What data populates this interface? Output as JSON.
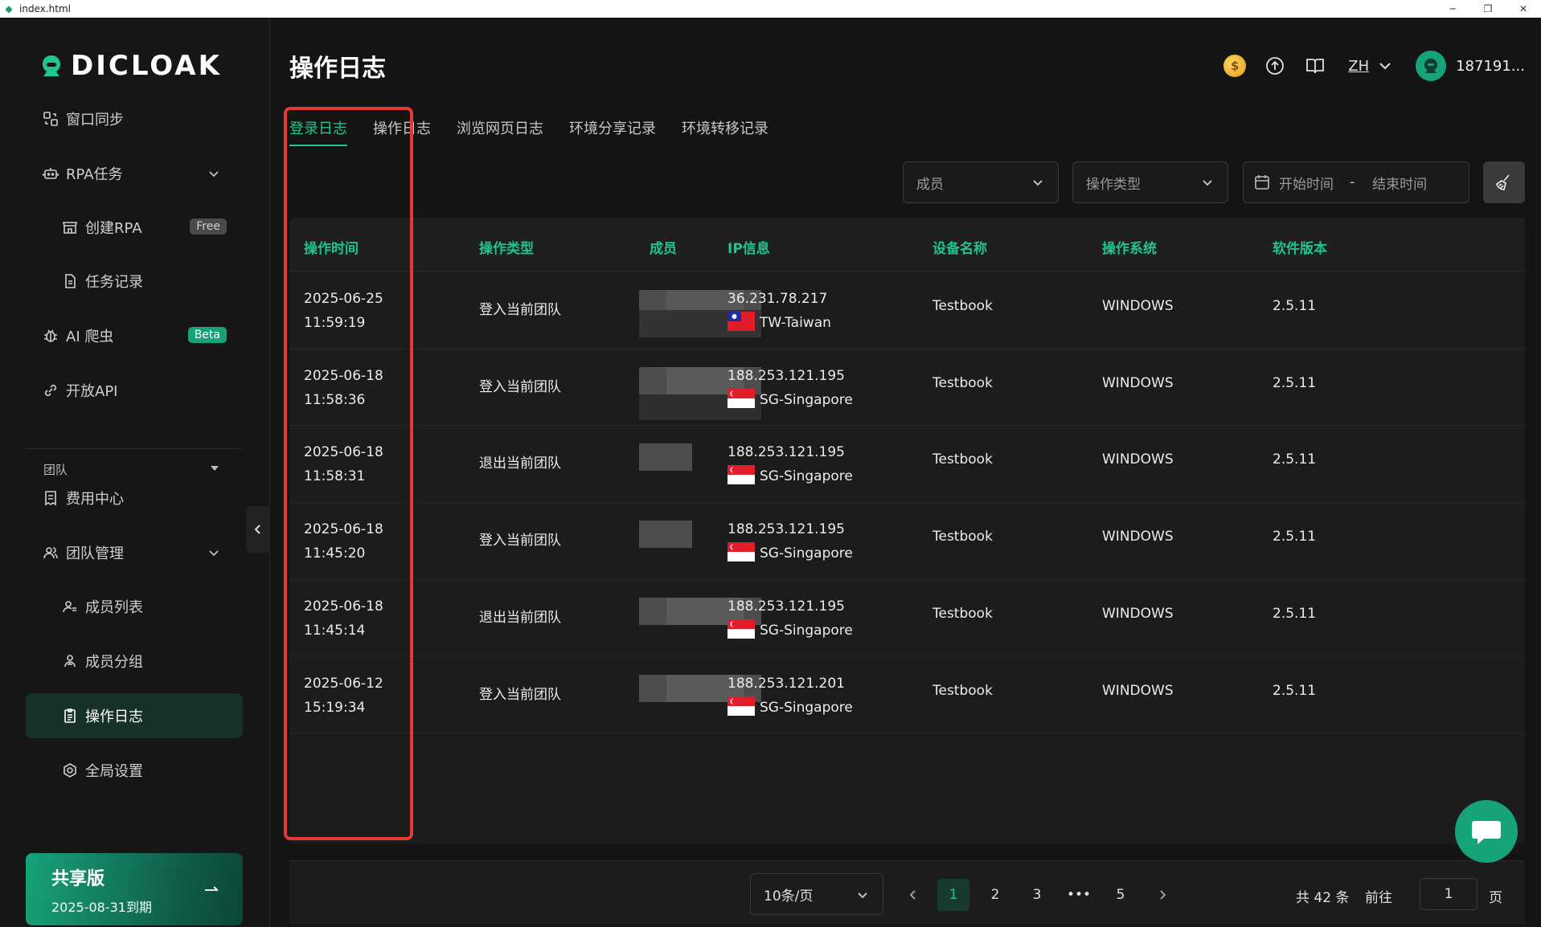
{
  "window": {
    "title": "index.html"
  },
  "brand": {
    "name": "DICLOAK",
    "accent": "#21c38f"
  },
  "sidebar": {
    "items": [
      {
        "label": "窗口同步",
        "icon": "window-sync-icon"
      },
      {
        "label": "RPA任务",
        "icon": "robot-icon"
      },
      {
        "label": "创建RPA",
        "icon": "store-icon",
        "badge": "Free"
      },
      {
        "label": "任务记录",
        "icon": "document-icon"
      },
      {
        "label": "AI 爬虫",
        "icon": "bug-icon",
        "badge": "Beta"
      },
      {
        "label": "开放API",
        "icon": "link-icon"
      },
      {
        "label": "费用中心",
        "icon": "receipt-icon"
      },
      {
        "label": "团队管理",
        "icon": "team-icon"
      },
      {
        "label": "成员列表",
        "icon": "member-list-icon"
      },
      {
        "label": "成员分组",
        "icon": "member-group-icon"
      },
      {
        "label": "操作日志",
        "icon": "log-icon"
      },
      {
        "label": "全局设置",
        "icon": "settings-icon"
      }
    ],
    "section_label": "团队",
    "plan": {
      "title": "共享版",
      "expiry": "2025-08-31到期"
    }
  },
  "header": {
    "title": "操作日志",
    "lang": "ZH",
    "username": "187191..."
  },
  "tabs": [
    "登录日志",
    "操作日志",
    "浏览网页日志",
    "环境分享记录",
    "环境转移记录"
  ],
  "filters": {
    "member_placeholder": "成员",
    "type_placeholder": "操作类型",
    "start_placeholder": "开始时间",
    "end_placeholder": "结束时间",
    "range_sep": "-"
  },
  "table": {
    "columns": [
      "操作时间",
      "操作类型",
      "成员",
      "IP信息",
      "设备名称",
      "操作系统",
      "软件版本"
    ],
    "rows": [
      {
        "date": "2025-06-25",
        "time": "11:59:19",
        "type": "登入当前团队",
        "ip": "36.231.78.217",
        "region": "TW-Taiwan",
        "flag": "tw",
        "device": "Testbook",
        "os": "WINDOWS",
        "version": "2.5.11"
      },
      {
        "date": "2025-06-18",
        "time": "11:58:36",
        "type": "登入当前团队",
        "ip": "188.253.121.195",
        "region": "SG-Singapore",
        "flag": "sg",
        "device": "Testbook",
        "os": "WINDOWS",
        "version": "2.5.11"
      },
      {
        "date": "2025-06-18",
        "time": "11:58:31",
        "type": "退出当前团队",
        "ip": "188.253.121.195",
        "region": "SG-Singapore",
        "flag": "sg",
        "device": "Testbook",
        "os": "WINDOWS",
        "version": "2.5.11"
      },
      {
        "date": "2025-06-18",
        "time": "11:45:20",
        "type": "登入当前团队",
        "ip": "188.253.121.195",
        "region": "SG-Singapore",
        "flag": "sg",
        "device": "Testbook",
        "os": "WINDOWS",
        "version": "2.5.11"
      },
      {
        "date": "2025-06-18",
        "time": "11:45:14",
        "type": "退出当前团队",
        "ip": "188.253.121.195",
        "region": "SG-Singapore",
        "flag": "sg",
        "device": "Testbook",
        "os": "WINDOWS",
        "version": "2.5.11"
      },
      {
        "date": "2025-06-12",
        "time": "15:19:34",
        "type": "登入当前团队",
        "ip": "188.253.121.201",
        "region": "SG-Singapore",
        "flag": "sg",
        "device": "Testbook",
        "os": "WINDOWS",
        "version": "2.5.11"
      }
    ]
  },
  "pagination": {
    "page_size": "10条/页",
    "pages": [
      "1",
      "2",
      "3",
      "•••",
      "5"
    ],
    "current": "1",
    "total": "共 42 条",
    "goto_label": "前往",
    "goto_value": "1",
    "page_suffix": "页"
  }
}
